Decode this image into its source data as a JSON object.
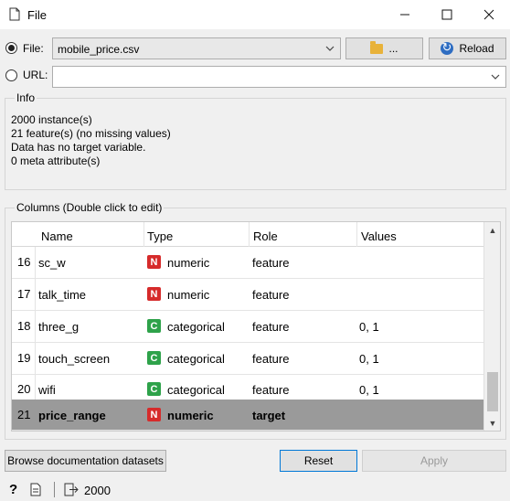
{
  "window": {
    "title": "File"
  },
  "source": {
    "file_label": "File:",
    "file_value": "mobile_price.csv",
    "browse_label": "...",
    "reload_label": "Reload",
    "url_label": "URL:",
    "url_value": ""
  },
  "info": {
    "title": "Info",
    "lines": [
      "2000 instance(s)",
      "21 feature(s) (no missing values)",
      "Data has no target variable.",
      "0 meta attribute(s)"
    ]
  },
  "columns": {
    "title": "Columns (Double click to edit)",
    "headers": [
      "Name",
      "Type",
      "Role",
      "Values"
    ],
    "rows": [
      {
        "num": "16",
        "name": "sc_w",
        "badge": "N",
        "type": "numeric",
        "role": "feature",
        "values": ""
      },
      {
        "num": "17",
        "name": "talk_time",
        "badge": "N",
        "type": "numeric",
        "role": "feature",
        "values": ""
      },
      {
        "num": "18",
        "name": "three_g",
        "badge": "C",
        "type": "categorical",
        "role": "feature",
        "values": "0, 1"
      },
      {
        "num": "19",
        "name": "touch_screen",
        "badge": "C",
        "type": "categorical",
        "role": "feature",
        "values": "0, 1"
      },
      {
        "num": "20",
        "name": "wifi",
        "badge": "C",
        "type": "categorical",
        "role": "feature",
        "values": "0, 1"
      },
      {
        "num": "21",
        "name": "price_range",
        "badge": "N",
        "type": "numeric",
        "role": "target",
        "values": ""
      }
    ]
  },
  "buttons": {
    "docs": "Browse documentation datasets",
    "reset": "Reset",
    "apply": "Apply"
  },
  "status": {
    "output_count": "2000"
  },
  "colors": {
    "numeric": "#d62b2b",
    "categorical": "#2ea24a",
    "selected_row": "#9a9a9a"
  }
}
